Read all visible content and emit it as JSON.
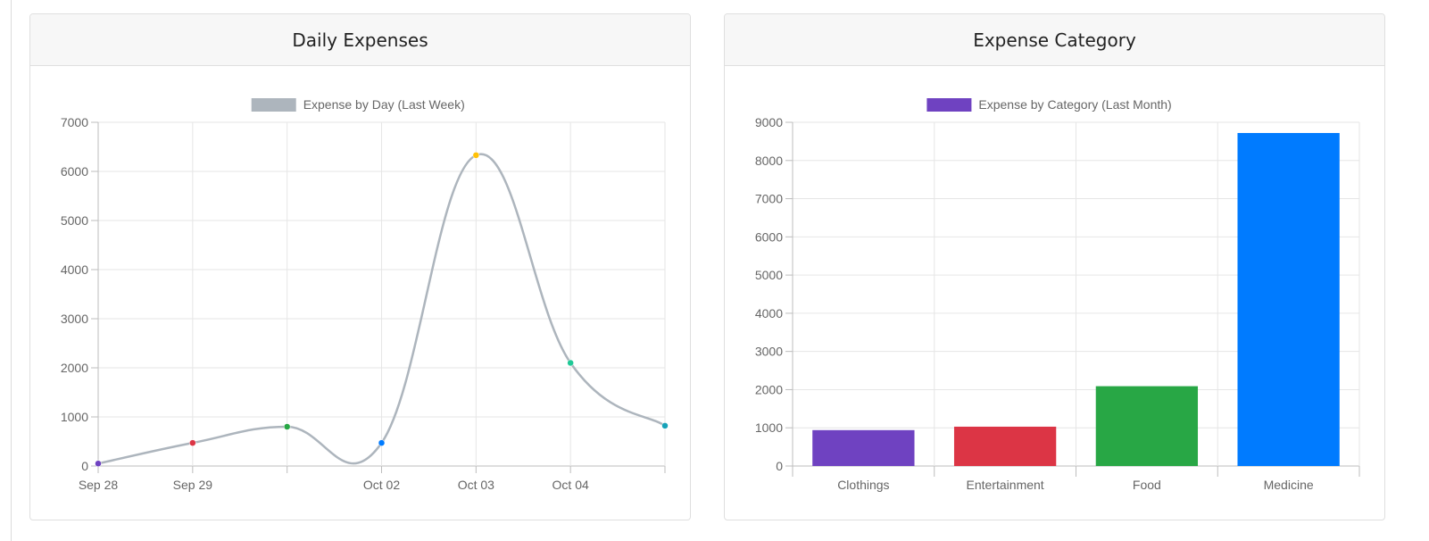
{
  "cards": [
    {
      "title": "Daily Expenses"
    },
    {
      "title": "Expense Category"
    }
  ],
  "chart_data": [
    {
      "type": "line",
      "legend": "Expense by Day (Last Week)",
      "legend_color": "#adb5bd",
      "line_color": "#adb5bd",
      "x_tick_labels": [
        "Sep 28",
        "Sep 29",
        "",
        "Oct 02",
        "Oct 03",
        "Oct 04",
        ""
      ],
      "values": [
        50,
        470,
        800,
        470,
        6330,
        2100,
        820
      ],
      "point_colors": [
        "#6f42c1",
        "#dc3545",
        "#28a745",
        "#007bff",
        "#ffc107",
        "#20c997",
        "#17a2b8"
      ],
      "ylim": [
        0,
        7000
      ],
      "y_ticks": [
        0,
        1000,
        2000,
        3000,
        4000,
        5000,
        6000,
        7000
      ],
      "grid": true,
      "legend_position": "top"
    },
    {
      "type": "bar",
      "legend": "Expense by Category (Last Month)",
      "legend_color": "#6f42c1",
      "categories": [
        "Clothings",
        "Entertainment",
        "Food",
        "Medicine"
      ],
      "values": [
        940,
        1030,
        2090,
        8720
      ],
      "bar_colors": [
        "#6f42c1",
        "#dc3545",
        "#28a745",
        "#007bff"
      ],
      "ylim": [
        0,
        9000
      ],
      "y_ticks": [
        0,
        1000,
        2000,
        3000,
        4000,
        5000,
        6000,
        7000,
        8000,
        9000
      ],
      "grid": true,
      "legend_position": "top"
    }
  ]
}
